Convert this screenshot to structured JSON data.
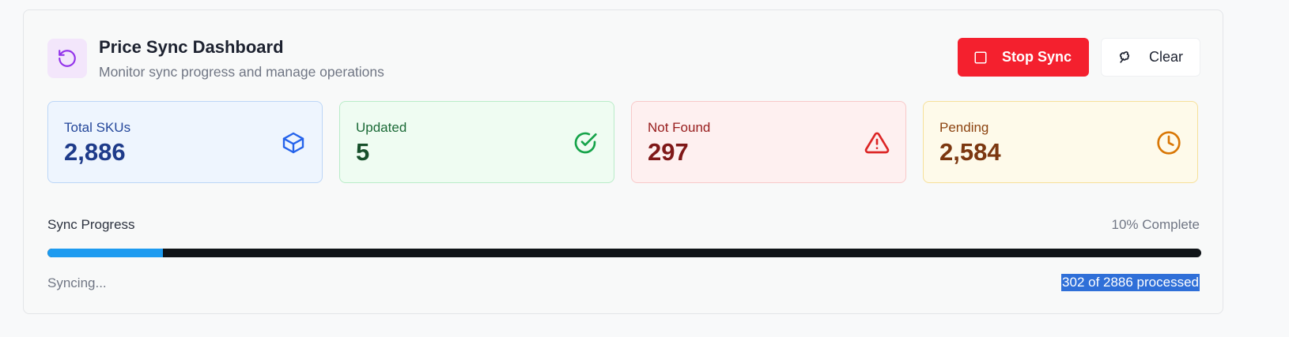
{
  "header": {
    "title": "Price Sync Dashboard",
    "subtitle": "Monitor sync progress and manage operations",
    "icon": "refresh-icon"
  },
  "actions": {
    "stop_label": "Stop Sync",
    "stop_icon": "square-stop-icon",
    "clear_label": "Clear",
    "clear_icon": "eraser-icon"
  },
  "stats": {
    "total": {
      "label": "Total SKUs",
      "value": "2,886",
      "icon": "box-icon",
      "color": "#2563eb"
    },
    "updated": {
      "label": "Updated",
      "value": "5",
      "icon": "check-circle-icon",
      "color": "#16a34a"
    },
    "not_found": {
      "label": "Not Found",
      "value": "297",
      "icon": "alert-triangle-icon",
      "color": "#dc2626"
    },
    "pending": {
      "label": "Pending",
      "value": "2,584",
      "icon": "clock-icon",
      "color": "#d97706"
    }
  },
  "progress": {
    "label": "Sync Progress",
    "percent_text": "10% Complete",
    "fraction": 0.1,
    "status": "Syncing...",
    "processed_text": "302 of 2886 processed"
  },
  "colors": {
    "stop_button": "#f4202e",
    "progress_fill": "#1d9bf0",
    "progress_track": "#101418",
    "accent_purple": "#9333ea"
  }
}
